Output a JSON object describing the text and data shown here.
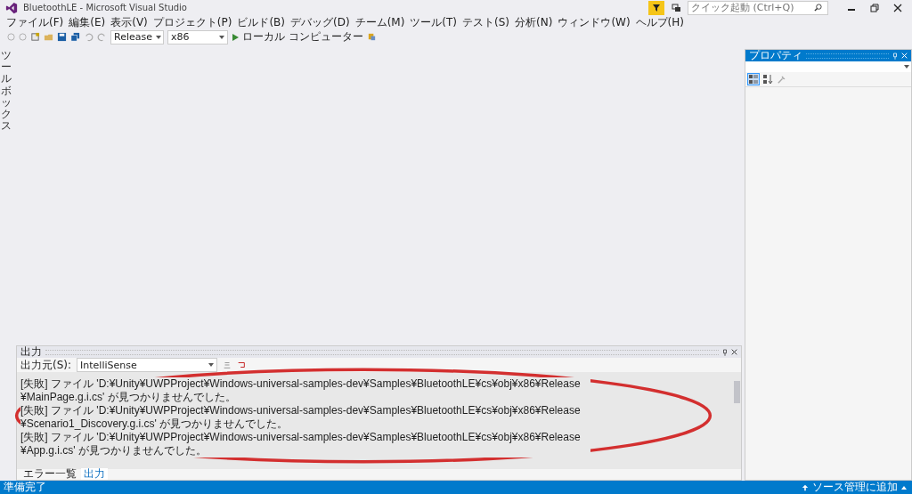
{
  "window": {
    "title": "BluetoothLE - Microsoft Visual Studio"
  },
  "quick_launch": {
    "placeholder": "クイック起動 (Ctrl+Q)"
  },
  "menu": [
    "ファイル(F)",
    "編集(E)",
    "表示(V)",
    "プロジェクト(P)",
    "ビルド(B)",
    "デバッグ(D)",
    "チーム(M)",
    "ツール(T)",
    "テスト(S)",
    "分析(N)",
    "ウィンドウ(W)",
    "ヘルプ(H)"
  ],
  "toolbar": {
    "configuration": "Release",
    "platform": "x86",
    "run_target": "ローカル コンピューター"
  },
  "toolbox_tab": {
    "label": "ツールボックス"
  },
  "properties_panel": {
    "title": "プロパティ"
  },
  "output_panel": {
    "title": "出力",
    "source_label": "出力元(S):",
    "source": "IntelliSense",
    "lines": [
      "[失敗] ファイル 'D:¥Unity¥UWPProject¥Windows-universal-samples-dev¥Samples¥BluetoothLE¥cs¥obj¥x86¥Release¥MainPage.g.i.cs' が見つかりませんでした。",
      "[失敗] ファイル 'D:¥Unity¥UWPProject¥Windows-universal-samples-dev¥Samples¥BluetoothLE¥cs¥obj¥x86¥Release¥Scenario1_Discovery.g.i.cs' が見つかりませんでした。",
      "[失敗] ファイル 'D:¥Unity¥UWPProject¥Windows-universal-samples-dev¥Samples¥BluetoothLE¥cs¥obj¥x86¥Release¥App.g.i.cs' が見つかりませんでした。"
    ]
  },
  "bottom_tabs": [
    {
      "label": "エラー一覧",
      "selected": false
    },
    {
      "label": "出力",
      "selected": true
    }
  ],
  "status_bar": {
    "left": "準備完了",
    "right": "ソース管理に追加"
  }
}
